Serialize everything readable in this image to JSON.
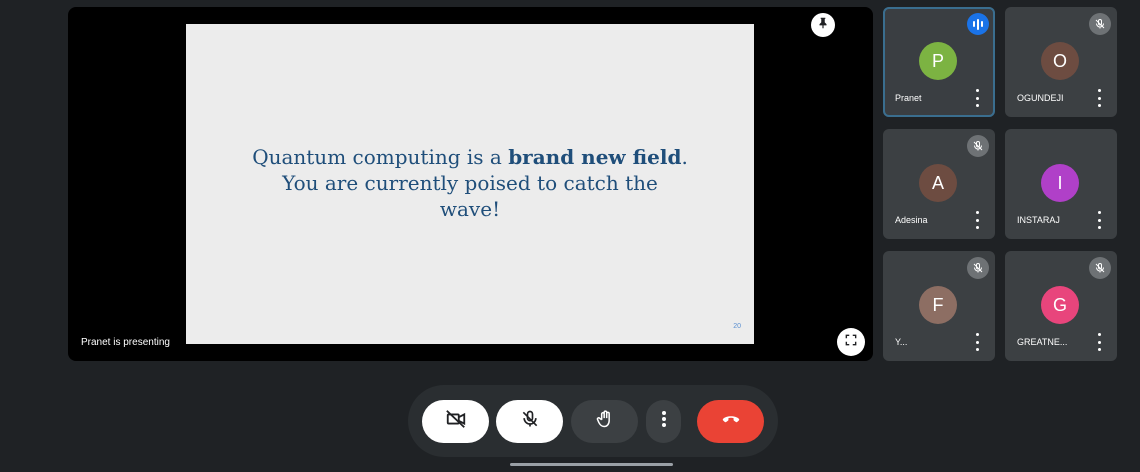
{
  "stage": {
    "slide": {
      "text_plain_1": "Quantum computing is a ",
      "text_bold_1": "brand new field",
      "text_plain_2": ".",
      "text_line_2": "You are currently poised to catch the",
      "text_line_3": "wave!",
      "page_number": "20"
    },
    "presenter_label": "Pranet is presenting",
    "pin_icon": "pin-icon",
    "fullscreen_icon": "fullscreen-icon"
  },
  "participants": [
    {
      "initial": "P",
      "name": "Pranet",
      "avatar_color": "#7cb342",
      "status": "speaking"
    },
    {
      "initial": "O",
      "name": "OGUNDEJI",
      "avatar_color": "#6d4c41",
      "status": "muted"
    },
    {
      "initial": "A",
      "name": "Adesina",
      "avatar_color": "#6d4c41",
      "status": "muted"
    },
    {
      "initial": "I",
      "name": "INSTARAJ",
      "avatar_color": "#b040c8",
      "status": "none"
    },
    {
      "initial": "F",
      "name": "Y...",
      "avatar_color": "#8d6e63",
      "status": "muted"
    },
    {
      "initial": "G",
      "name": "GREATNE...",
      "avatar_color": "#e8457c",
      "status": "muted"
    }
  ],
  "controls": {
    "camera": "camera-off-icon",
    "mic": "mic-off-icon",
    "raise_hand": "raise-hand-icon",
    "more": "more-options-icon",
    "end_call": "end-call-icon"
  },
  "colors": {
    "background": "#1f2225",
    "tile": "#3c4043",
    "end_call": "#ea4335",
    "slide_text": "#1f4e7a"
  }
}
